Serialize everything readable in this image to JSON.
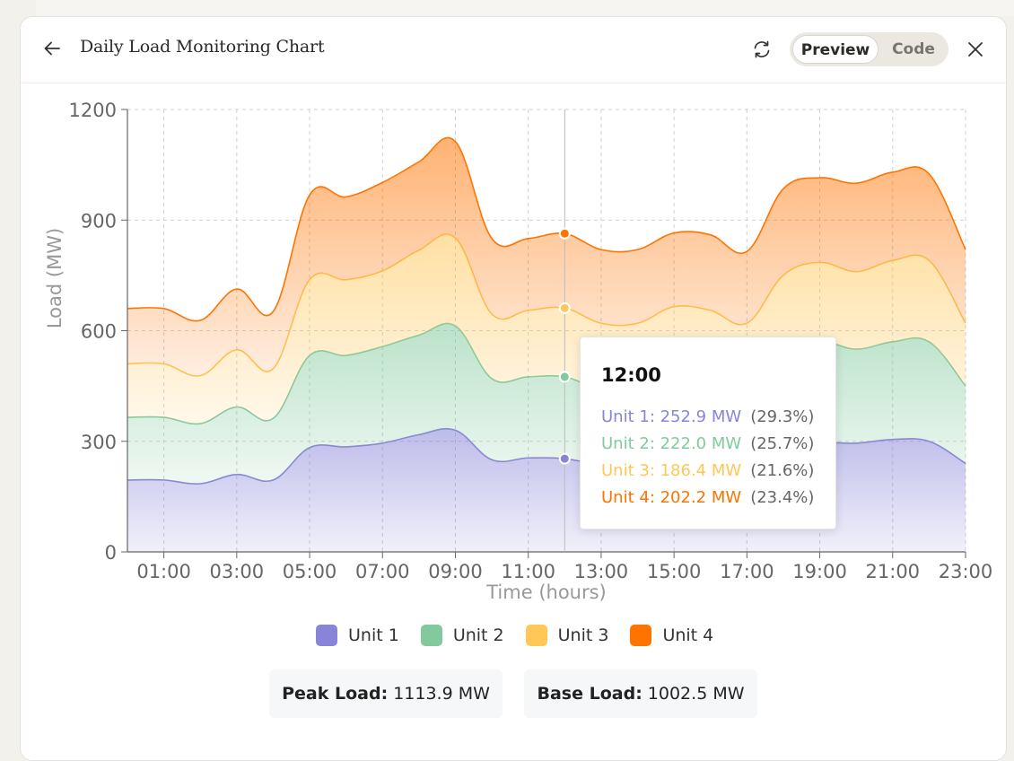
{
  "header": {
    "title": "Daily Load Monitoring Chart",
    "toggle": {
      "preview": "Preview",
      "code": "Code"
    }
  },
  "chart_data": {
    "type": "area",
    "stacked": true,
    "xlabel": "Time (hours)",
    "ylabel": "Load (MW)",
    "ylim": [
      0,
      1200
    ],
    "yticks": [
      "0",
      "300",
      "600",
      "900",
      "1200"
    ],
    "xticks": [
      "01:00",
      "03:00",
      "05:00",
      "07:00",
      "09:00",
      "11:00",
      "13:00",
      "15:00",
      "17:00",
      "19:00",
      "21:00",
      "23:00"
    ],
    "grid": true,
    "x": [
      "00:00",
      "01:00",
      "02:00",
      "03:00",
      "04:00",
      "05:00",
      "06:00",
      "07:00",
      "08:00",
      "09:00",
      "10:00",
      "11:00",
      "12:00",
      "13:00",
      "14:00",
      "15:00",
      "16:00",
      "17:00",
      "18:00",
      "19:00",
      "20:00",
      "21:00",
      "22:00",
      "23:00"
    ],
    "series": [
      {
        "name": "Unit 1",
        "color": "#8884d8",
        "values": [
          195,
          195,
          185,
          210,
          195,
          283,
          285,
          295,
          318,
          330,
          250,
          255,
          252.9,
          235,
          225,
          260,
          245,
          220,
          270,
          295,
          295,
          305,
          300,
          240
        ]
      },
      {
        "name": "Unit 2",
        "color": "#82ca9d",
        "values": [
          170,
          170,
          163,
          183,
          167,
          250,
          248,
          262,
          270,
          283,
          220,
          220,
          222.0,
          205,
          210,
          220,
          215,
          200,
          260,
          275,
          255,
          265,
          270,
          210
        ]
      },
      {
        "name": "Unit 3",
        "color": "#ffc658",
        "values": [
          145,
          145,
          130,
          155,
          135,
          205,
          205,
          205,
          230,
          238,
          175,
          180,
          186.4,
          180,
          185,
          185,
          195,
          200,
          220,
          215,
          210,
          220,
          220,
          170
        ]
      },
      {
        "name": "Unit 4",
        "color": "#ff7300",
        "values": [
          150,
          150,
          150,
          165,
          155,
          230,
          225,
          240,
          240,
          262,
          205,
          195,
          202.2,
          200,
          200,
          200,
          205,
          195,
          235,
          230,
          240,
          240,
          235,
          200
        ]
      }
    ],
    "legend": "bottom-center",
    "tooltip": {
      "title": "12:00",
      "rows": [
        {
          "label": "Unit 1: 252.9 MW",
          "pct": "(29.3%)"
        },
        {
          "label": "Unit 2: 222.0 MW",
          "pct": "(25.7%)"
        },
        {
          "label": "Unit 3: 186.4 MW",
          "pct": "(21.6%)"
        },
        {
          "label": "Unit 4: 202.2 MW",
          "pct": "(23.4%)"
        }
      ]
    }
  },
  "legend_items": [
    "Unit 1",
    "Unit 2",
    "Unit 3",
    "Unit 4"
  ],
  "stats": {
    "peak_label": "Peak Load:",
    "peak_value": "1113.9 MW",
    "base_label": "Base Load:",
    "base_value": "1002.5 MW"
  },
  "icons": {
    "back": "arrow-left-icon",
    "refresh": "refresh-icon",
    "close": "close-icon"
  }
}
